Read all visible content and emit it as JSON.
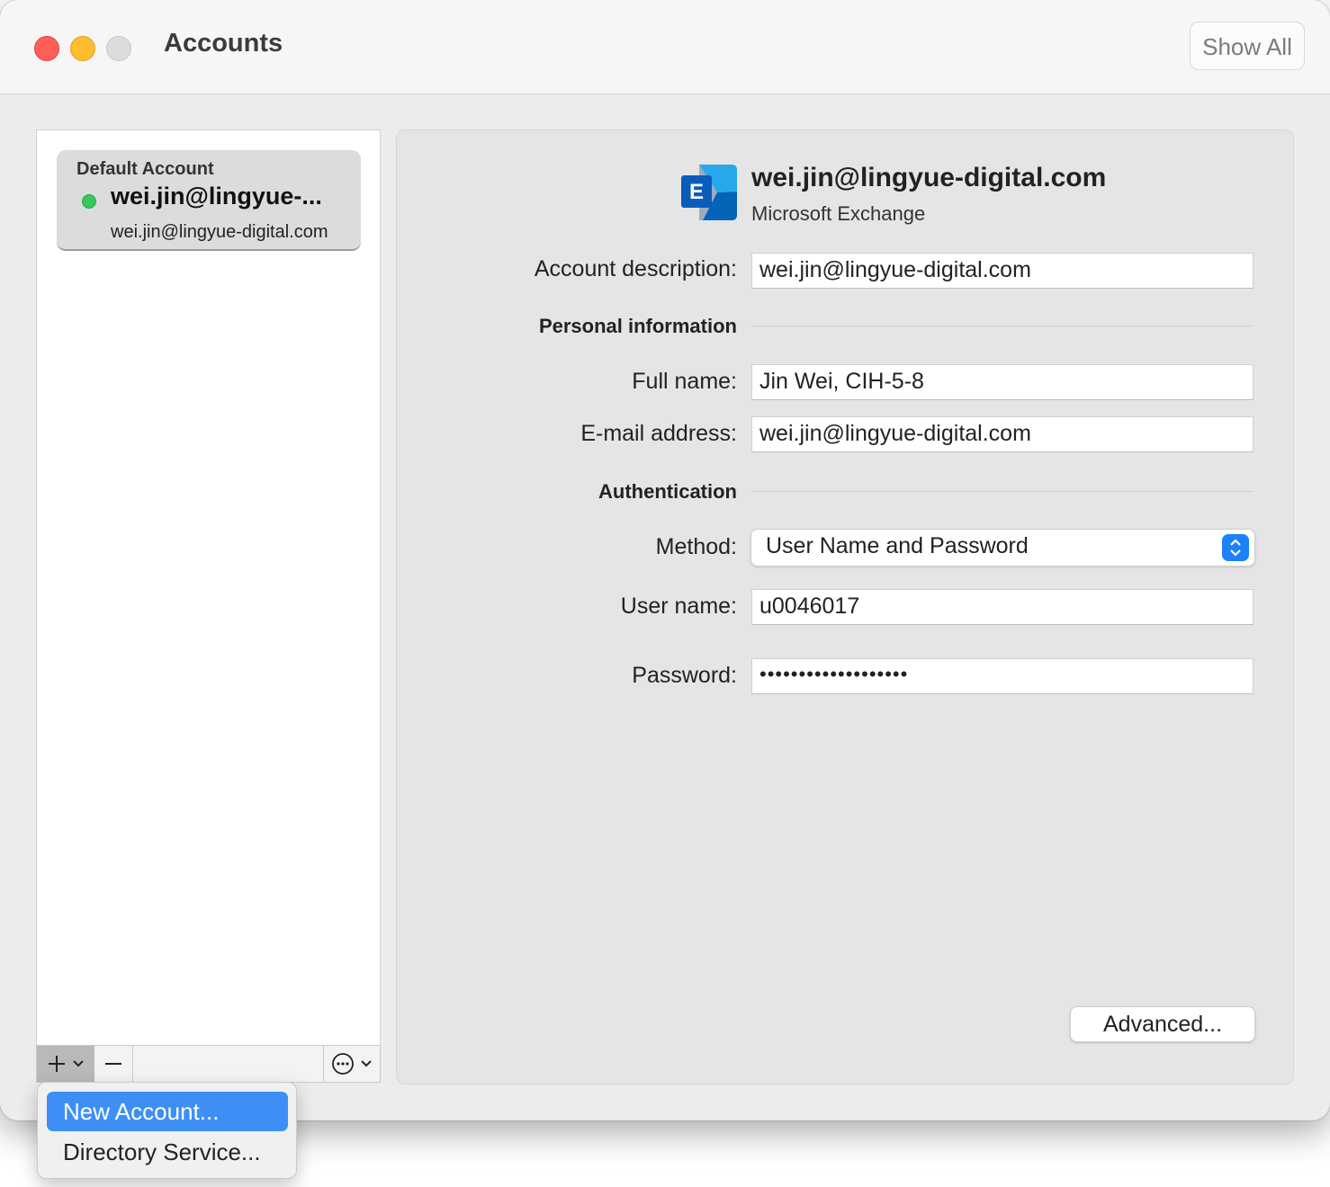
{
  "window": {
    "title": "Accounts",
    "show_all_label": "Show All"
  },
  "sidebar": {
    "accounts": [
      {
        "section_label": "Default Account",
        "name": "wei.jin@lingyue-...",
        "email": "wei.jin@lingyue-digital.com",
        "status": "online",
        "status_color": "#34c759"
      }
    ],
    "toolbar": {
      "add_icon": "plus-icon",
      "remove_icon": "minus-icon",
      "more_icon": "ellipsis-circle-icon"
    }
  },
  "detail": {
    "header_email": "wei.jin@lingyue-digital.com",
    "account_type": "Microsoft Exchange",
    "account_description_label": "Account description:",
    "account_description": "wei.jin@lingyue-digital.com",
    "personal_section": "Personal information",
    "full_name_label": "Full name:",
    "full_name": "Jin Wei, CIH-5-8",
    "email_label": "E-mail address:",
    "email": "wei.jin@lingyue-digital.com",
    "auth_section": "Authentication",
    "method_label": "Method:",
    "method": "User Name and Password",
    "username_label": "User name:",
    "username": "u0046017",
    "password_label": "Password:",
    "password_mask": "•••••••••••••••••••",
    "advanced_label": "Advanced...",
    "accent_color": "#1a82fb"
  },
  "add_menu": {
    "items": [
      {
        "label": "New Account...",
        "selected": true
      },
      {
        "label": "Directory Service...",
        "selected": false
      }
    ]
  }
}
